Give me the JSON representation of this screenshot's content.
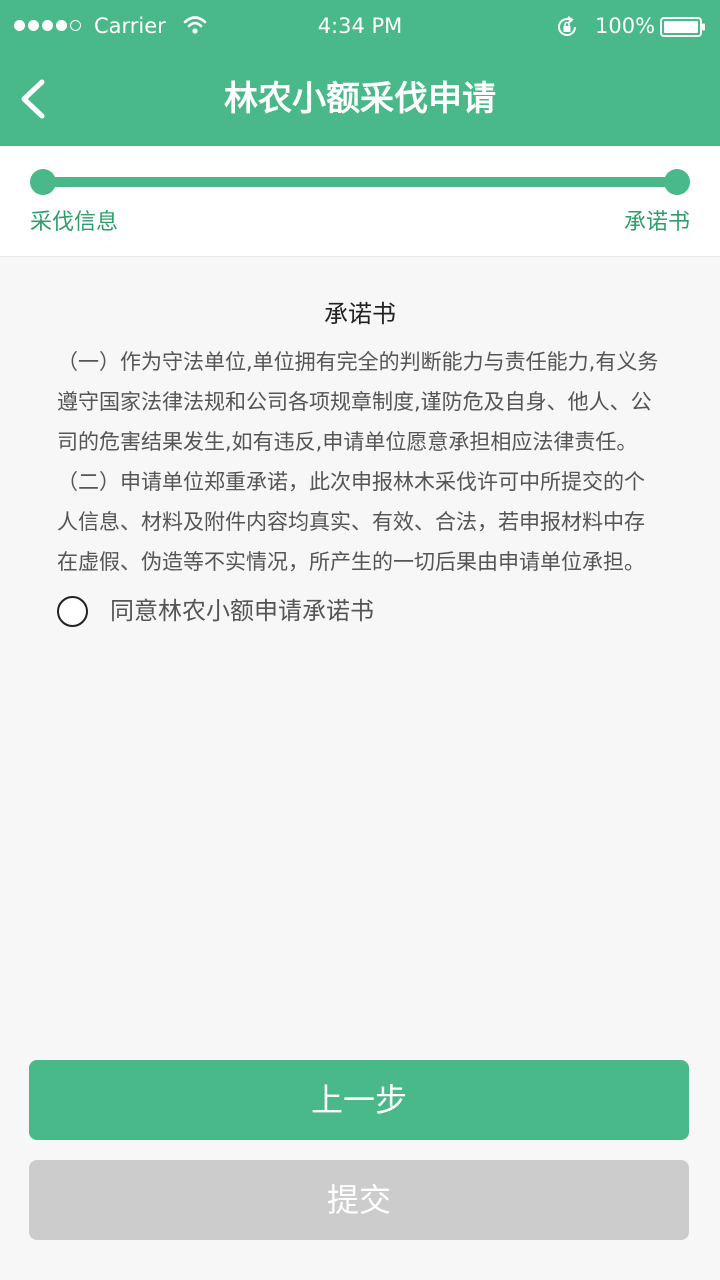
{
  "status_bar": {
    "carrier": "Carrier",
    "time": "4:34 PM",
    "battery": "100%"
  },
  "nav": {
    "title": "林农小额采伐申请",
    "back_icon": "chevron-left-icon"
  },
  "progress": {
    "step_start": "采伐信息",
    "step_end": "承诺书",
    "fraction": 1.0
  },
  "document": {
    "title": "承诺书",
    "lines": [
      "（一）作为守法单位,单位拥有完全的判断能力与责任能力,有义务",
      "遵守国家法律法规和公司各项规章制度,谨防危及自身、他人、公",
      "司的危害结果发生,如有违反,申请单位愿意承担相应法律责任。",
      "（二）申请单位郑重承诺，此次申报林木采伐许可中所提交的个",
      "人信息、材料及附件内容均真实、有效、合法，若申报材料中存",
      "在虚假、伪造等不实情况，所产生的一切后果由申请单位承担。"
    ]
  },
  "agreement": {
    "label": "同意林农小额申请承诺书",
    "checked": false
  },
  "buttons": {
    "prev": "上一步",
    "submit": "提交"
  },
  "colors": {
    "primary": "#4ab98a",
    "step_text": "#2e9e6b",
    "disabled": "#cccccc"
  }
}
